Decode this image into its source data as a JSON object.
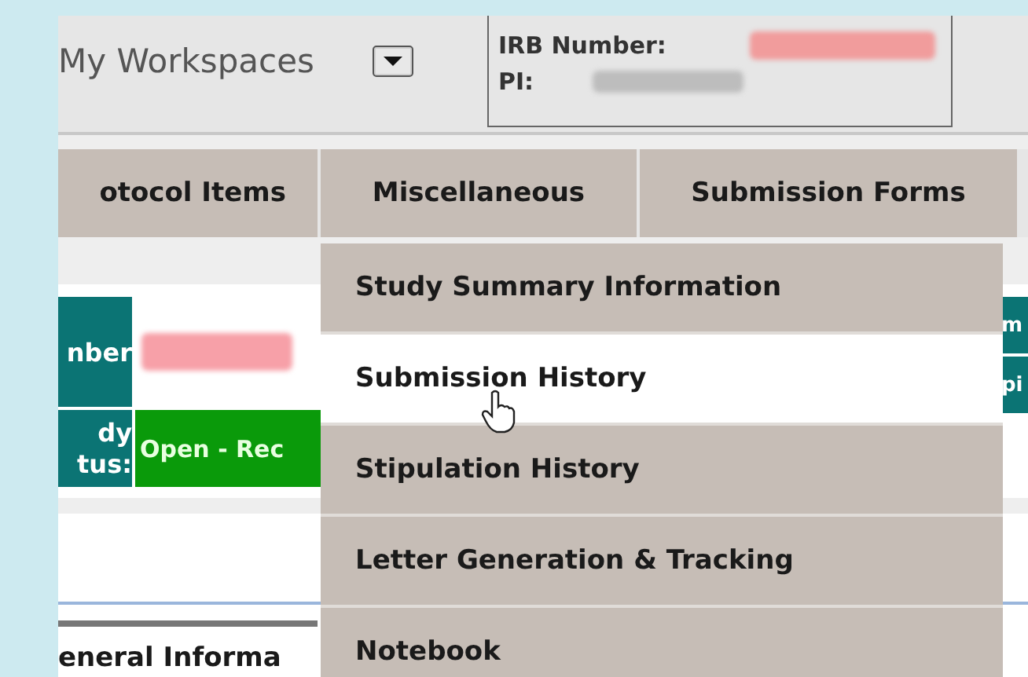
{
  "header": {
    "workspace_label": "My Workspaces",
    "irb_number_label": "IRB Number:",
    "pi_label": "PI:"
  },
  "tabs": [
    {
      "label": "otocol Items"
    },
    {
      "label": "Miscellaneous"
    },
    {
      "label": "Submission Forms"
    }
  ],
  "menu": {
    "items": [
      {
        "label": "Study Summary Information",
        "selected": false
      },
      {
        "label": "Submission History",
        "selected": true
      },
      {
        "label": "Stipulation History",
        "selected": false
      },
      {
        "label": "Letter Generation & Tracking",
        "selected": false
      },
      {
        "label": "Notebook",
        "selected": false
      }
    ]
  },
  "study": {
    "number_label": "nber",
    "status_label": "dy\ntus:",
    "status_value": "Open - Rec"
  },
  "right_cells": [
    "m",
    "pi"
  ],
  "section_title": "eneral Informa"
}
